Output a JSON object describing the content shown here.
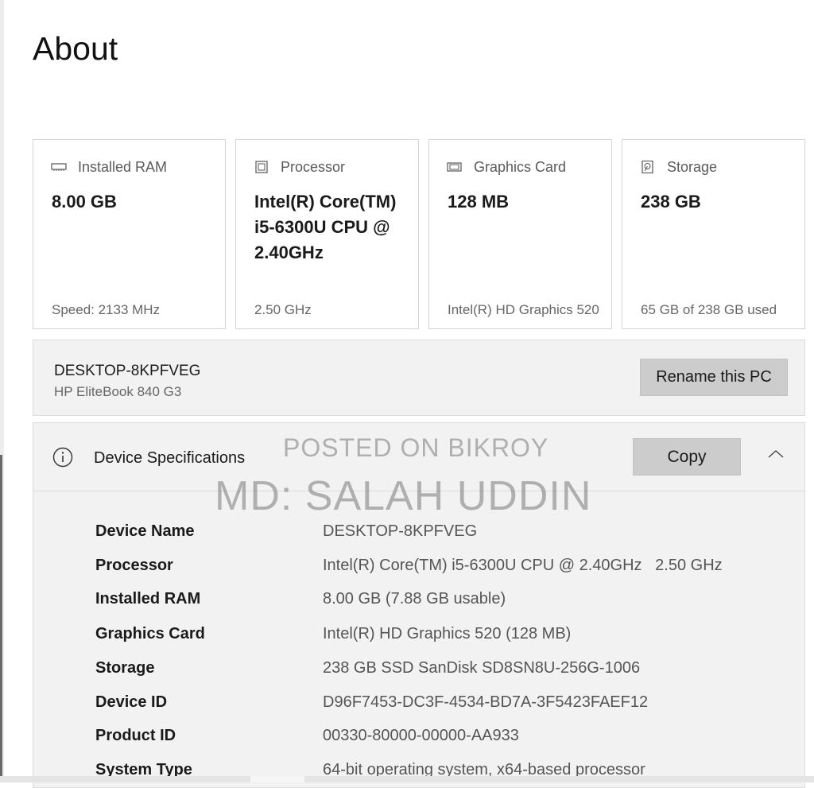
{
  "page": {
    "title": "About"
  },
  "cards": [
    {
      "icon": "ram-icon",
      "title": "Installed RAM",
      "value": "8.00 GB",
      "subtitle": "Speed: 2133 MHz"
    },
    {
      "icon": "processor-icon",
      "title": "Processor",
      "value": "Intel(R) Core(TM) i5-6300U CPU @ 2.40GHz",
      "subtitle": "2.50 GHz"
    },
    {
      "icon": "graphics-card-icon",
      "title": "Graphics Card",
      "value": "128 MB",
      "subtitle": "Intel(R) HD Graphics 520"
    },
    {
      "icon": "storage-icon",
      "title": "Storage",
      "value": "238 GB",
      "subtitle": "65 GB of 238 GB used"
    }
  ],
  "pc": {
    "name": "DESKTOP-8KPFVEG",
    "model": "HP EliteBook 840 G3",
    "rename_label": "Rename this PC"
  },
  "specs": {
    "title": "Device Specifications",
    "copy_label": "Copy",
    "icons": {
      "info": "info-icon",
      "collapse": "chevron-up-icon"
    },
    "rows": [
      {
        "label": "Device Name",
        "value": "DESKTOP-8KPFVEG"
      },
      {
        "label": "Processor",
        "value": "Intel(R) Core(TM) i5-6300U CPU @ 2.40GHz   2.50 GHz"
      },
      {
        "label": "Installed RAM",
        "value": "8.00 GB (7.88 GB usable)"
      },
      {
        "label": "Graphics Card",
        "value": "Intel(R) HD Graphics 520 (128 MB)"
      },
      {
        "label": "Storage",
        "value": "238 GB SSD SanDisk SD8SN8U-256G-1006"
      },
      {
        "label": "Device ID",
        "value": "D96F7453-DC3F-4534-BD7A-3F5423FAEF12"
      },
      {
        "label": "Product ID",
        "value": "00330-80000-00000-AA933"
      },
      {
        "label": "System Type",
        "value": "64-bit operating system, x64-based processor"
      }
    ]
  },
  "watermark": {
    "line1": "POSTED ON BIKROY",
    "line2": "MD: SALAH UDDIN"
  }
}
